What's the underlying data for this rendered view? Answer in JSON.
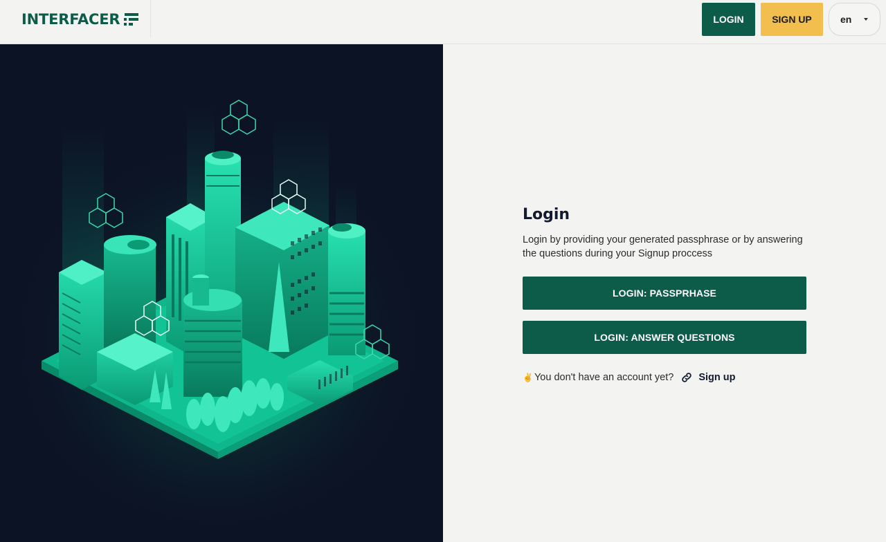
{
  "header": {
    "logo_text": "INTERFACER",
    "login_label": "LOGIN",
    "signup_label": "SIGN UP",
    "language": "en"
  },
  "hero": {
    "icon": "isometric-city-illustration"
  },
  "login": {
    "title": "Login",
    "description": "Login by providing your generated passphrase or by answering the questions during your Signup proccess",
    "passphrase_button": "LOGIN: PASSPRHASE",
    "questions_button": "LOGIN: ANSWER QUESTIONS",
    "no_account_prefix": "✌",
    "no_account_text": "You don't have an account yet?",
    "signup_link": "Sign up"
  },
  "colors": {
    "brand_green": "#0d5c4a",
    "accent_yellow": "#f2bf4e",
    "hero_background": "#0c1325",
    "page_background": "#f3f3f1"
  }
}
